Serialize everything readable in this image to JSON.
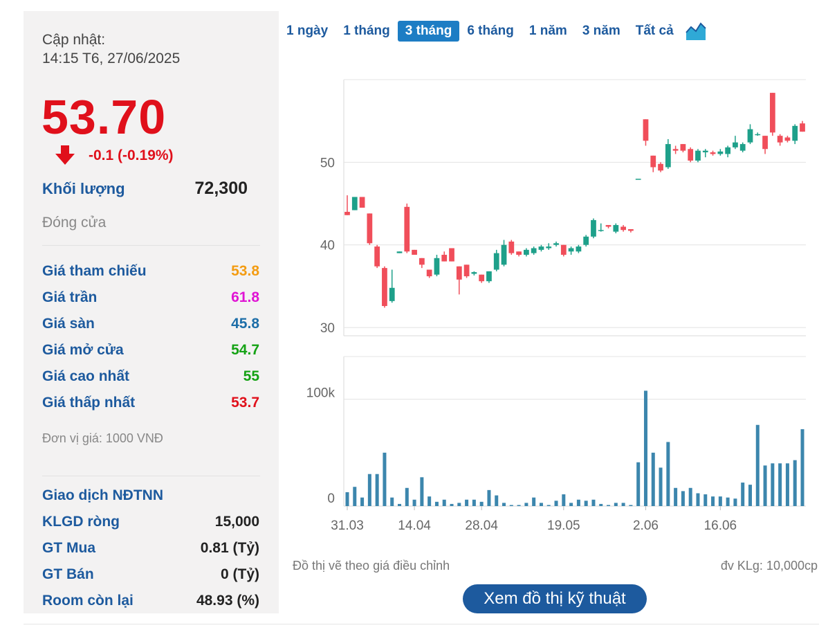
{
  "summary": {
    "update_label": "Cập nhật:",
    "update_time": "14:15 T6, 27/06/2025",
    "price": "53.70",
    "change": "-0.1 (-0.19%)",
    "volume_label": "Khối lượng",
    "volume_value": "72,300",
    "status": "Đóng cửa",
    "unit_note": "Đơn vị giá: 1000 VNĐ"
  },
  "price_rows": [
    {
      "label": "Giá tham chiếu",
      "value": "53.8",
      "color": "#f39c12"
    },
    {
      "label": "Giá trần",
      "value": "61.8",
      "color": "#e014d4"
    },
    {
      "label": "Giá sàn",
      "value": "45.8",
      "color": "#1d6ea8"
    },
    {
      "label": "Giá mở cửa",
      "value": "54.7",
      "color": "#14a214"
    },
    {
      "label": "Giá cao nhất",
      "value": "55",
      "color": "#14a214"
    },
    {
      "label": "Giá thấp nhất",
      "value": "53.7",
      "color": "#e0101b"
    }
  ],
  "foreign": {
    "title": "Giao dịch NĐTNN",
    "rows": [
      {
        "label": "KLGD ròng",
        "value": "15,000"
      },
      {
        "label": "GT Mua",
        "value": "0.81 (Tỷ)"
      },
      {
        "label": "GT Bán",
        "value": "0 (Tỷ)"
      },
      {
        "label": "Room còn lại",
        "value": "48.93 (%)"
      }
    ]
  },
  "range_tabs": [
    {
      "label": "1 ngày",
      "active": false
    },
    {
      "label": "1 tháng",
      "active": false
    },
    {
      "label": "3 tháng",
      "active": true
    },
    {
      "label": "6 tháng",
      "active": false
    },
    {
      "label": "1 năm",
      "active": false
    },
    {
      "label": "3 năm",
      "active": false
    },
    {
      "label": "Tất cả",
      "active": false
    }
  ],
  "chart_data": {
    "type": "candlestick",
    "x_ticks": [
      "31.03",
      "14.04",
      "28.04",
      "19.05",
      "2.06",
      "16.06"
    ],
    "price_ticks": [
      "30",
      "40",
      "50"
    ],
    "price_ylim": [
      29,
      60
    ],
    "volume_ticks": [
      "0",
      "100k"
    ],
    "volume_ylim": [
      0,
      140
    ],
    "up_color": "#1ea08a",
    "down_color": "#f04e5a",
    "candles": [
      {
        "o": 44.0,
        "c": 43.6,
        "h": 46.0,
        "l": 43.6,
        "v": 13
      },
      {
        "o": 44.2,
        "c": 45.8,
        "h": 45.8,
        "l": 44.2,
        "v": 18
      },
      {
        "o": 45.8,
        "c": 44.5,
        "h": 45.8,
        "l": 44.5,
        "v": 8
      },
      {
        "o": 43.8,
        "c": 40.2,
        "h": 43.8,
        "l": 40.0,
        "v": 30
      },
      {
        "o": 39.8,
        "c": 37.4,
        "h": 40.0,
        "l": 37.2,
        "v": 30
      },
      {
        "o": 37.2,
        "c": 32.6,
        "h": 37.4,
        "l": 32.4,
        "v": 50
      },
      {
        "o": 33.2,
        "c": 34.8,
        "h": 37.0,
        "l": 33.0,
        "v": 8
      },
      {
        "o": 39.0,
        "c": 39.2,
        "h": 39.2,
        "l": 39.0,
        "v": 2
      },
      {
        "o": 44.6,
        "c": 39.2,
        "h": 45.0,
        "l": 39.0,
        "v": 17
      },
      {
        "o": 39.4,
        "c": 38.8,
        "h": 39.4,
        "l": 38.8,
        "v": 6
      },
      {
        "o": 38.4,
        "c": 37.6,
        "h": 38.4,
        "l": 37.2,
        "v": 27
      },
      {
        "o": 37.0,
        "c": 36.2,
        "h": 37.0,
        "l": 36.0,
        "v": 9
      },
      {
        "o": 36.4,
        "c": 38.4,
        "h": 38.8,
        "l": 36.2,
        "v": 4
      },
      {
        "o": 38.8,
        "c": 38.0,
        "h": 39.2,
        "l": 38.0,
        "v": 6
      },
      {
        "o": 39.6,
        "c": 38.0,
        "h": 39.6,
        "l": 38.0,
        "v": 2
      },
      {
        "o": 37.4,
        "c": 35.8,
        "h": 37.4,
        "l": 34.0,
        "v": 3
      },
      {
        "o": 37.6,
        "c": 36.2,
        "h": 37.6,
        "l": 36.0,
        "v": 6
      },
      {
        "o": 36.5,
        "c": 36.7,
        "h": 36.8,
        "l": 36.3,
        "v": 6
      },
      {
        "o": 36.4,
        "c": 35.6,
        "h": 36.4,
        "l": 35.4,
        "v": 4
      },
      {
        "o": 35.6,
        "c": 36.8,
        "h": 36.8,
        "l": 35.4,
        "v": 15
      },
      {
        "o": 37.0,
        "c": 39.0,
        "h": 39.4,
        "l": 36.8,
        "v": 10
      },
      {
        "o": 37.6,
        "c": 40.0,
        "h": 40.6,
        "l": 37.4,
        "v": 3
      },
      {
        "o": 40.4,
        "c": 39.0,
        "h": 40.6,
        "l": 38.8,
        "v": 1
      },
      {
        "o": 39.2,
        "c": 38.8,
        "h": 39.2,
        "l": 38.6,
        "v": 1
      },
      {
        "o": 38.8,
        "c": 39.4,
        "h": 39.6,
        "l": 38.6,
        "v": 3
      },
      {
        "o": 39.0,
        "c": 39.6,
        "h": 39.8,
        "l": 38.8,
        "v": 8
      },
      {
        "o": 39.4,
        "c": 39.8,
        "h": 40.0,
        "l": 39.2,
        "v": 3
      },
      {
        "o": 39.6,
        "c": 39.8,
        "h": 40.2,
        "l": 39.4,
        "v": 1
      },
      {
        "o": 40.0,
        "c": 40.2,
        "h": 40.4,
        "l": 39.8,
        "v": 5
      },
      {
        "o": 40.0,
        "c": 38.8,
        "h": 40.0,
        "l": 38.6,
        "v": 11
      },
      {
        "o": 39.2,
        "c": 39.6,
        "h": 39.8,
        "l": 38.8,
        "v": 3
      },
      {
        "o": 39.2,
        "c": 39.8,
        "h": 40.0,
        "l": 39.0,
        "v": 6
      },
      {
        "o": 40.0,
        "c": 41.0,
        "h": 41.2,
        "l": 39.8,
        "v": 5
      },
      {
        "o": 41.0,
        "c": 43.0,
        "h": 43.2,
        "l": 40.8,
        "v": 6
      },
      {
        "o": 41.8,
        "c": 41.8,
        "h": 42.6,
        "l": 41.6,
        "v": 2
      },
      {
        "o": 42.4,
        "c": 42.2,
        "h": 42.4,
        "l": 42.0,
        "v": 1
      },
      {
        "o": 41.6,
        "c": 42.4,
        "h": 42.6,
        "l": 41.4,
        "v": 3
      },
      {
        "o": 42.2,
        "c": 41.8,
        "h": 42.4,
        "l": 41.6,
        "v": 3
      },
      {
        "o": 41.9,
        "c": 41.7,
        "h": 41.9,
        "l": 41.5,
        "v": 1
      },
      {
        "o": 48.0,
        "c": 48.0,
        "h": 48.0,
        "l": 48.0,
        "v": 41
      },
      {
        "o": 55.2,
        "c": 52.6,
        "h": 55.2,
        "l": 52.0,
        "v": 108
      },
      {
        "o": 50.8,
        "c": 49.4,
        "h": 50.8,
        "l": 48.8,
        "v": 50
      },
      {
        "o": 49.8,
        "c": 49.0,
        "h": 50.0,
        "l": 48.8,
        "v": 36
      },
      {
        "o": 49.4,
        "c": 52.2,
        "h": 52.8,
        "l": 49.2,
        "v": 60
      },
      {
        "o": 51.6,
        "c": 51.4,
        "h": 52.0,
        "l": 51.0,
        "v": 17
      },
      {
        "o": 52.2,
        "c": 51.4,
        "h": 52.2,
        "l": 51.2,
        "v": 14
      },
      {
        "o": 51.6,
        "c": 50.2,
        "h": 51.8,
        "l": 50.0,
        "v": 17
      },
      {
        "o": 50.2,
        "c": 51.4,
        "h": 51.6,
        "l": 50.0,
        "v": 12
      },
      {
        "o": 51.2,
        "c": 51.4,
        "h": 51.6,
        "l": 50.6,
        "v": 11
      },
      {
        "o": 51.2,
        "c": 51.0,
        "h": 51.4,
        "l": 50.8,
        "v": 9
      },
      {
        "o": 51.0,
        "c": 51.3,
        "h": 51.6,
        "l": 50.8,
        "v": 9
      },
      {
        "o": 51.0,
        "c": 51.8,
        "h": 52.0,
        "l": 50.6,
        "v": 8
      },
      {
        "o": 51.8,
        "c": 52.4,
        "h": 53.2,
        "l": 51.6,
        "v": 7
      },
      {
        "o": 51.4,
        "c": 52.2,
        "h": 52.4,
        "l": 51.2,
        "v": 22
      },
      {
        "o": 52.4,
        "c": 54.0,
        "h": 54.6,
        "l": 52.2,
        "v": 20
      },
      {
        "o": 53.4,
        "c": 53.4,
        "h": 53.6,
        "l": 53.2,
        "v": 76
      },
      {
        "o": 53.2,
        "c": 51.6,
        "h": 53.2,
        "l": 51.0,
        "v": 38
      },
      {
        "o": 58.4,
        "c": 53.6,
        "h": 58.4,
        "l": 53.2,
        "v": 40
      },
      {
        "o": 53.2,
        "c": 52.4,
        "h": 53.4,
        "l": 52.0,
        "v": 40
      },
      {
        "o": 53.0,
        "c": 52.6,
        "h": 53.2,
        "l": 52.4,
        "v": 40
      },
      {
        "o": 52.6,
        "c": 54.4,
        "h": 54.6,
        "l": 52.2,
        "v": 43
      },
      {
        "o": 54.7,
        "c": 53.7,
        "h": 55.0,
        "l": 53.7,
        "v": 72
      }
    ]
  },
  "notes": {
    "left": "Đồ thị vẽ theo giá điều chỉnh",
    "right": "đv KLg: 10,000cp"
  },
  "tech_button": "Xem đồ thị kỹ thuật"
}
